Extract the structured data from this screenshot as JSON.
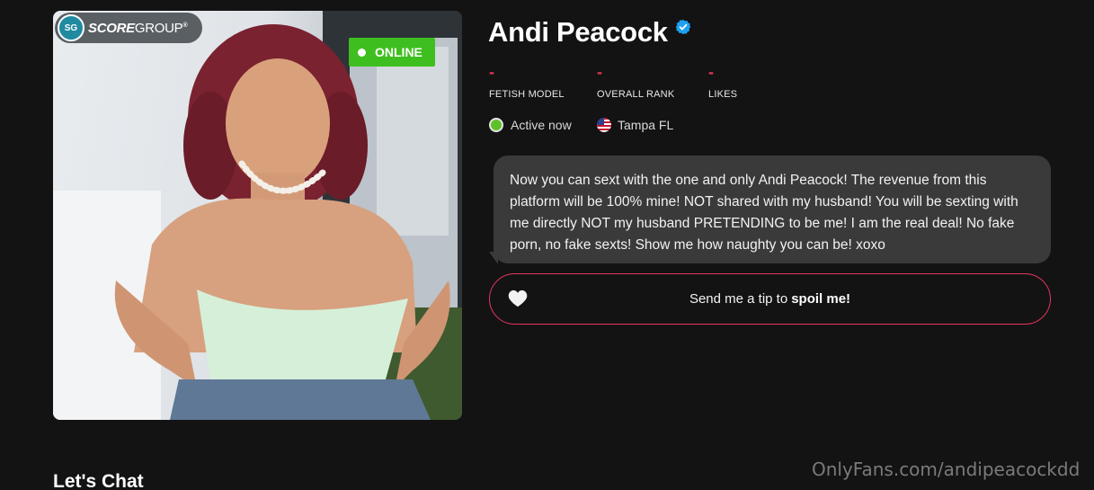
{
  "profile": {
    "name": "Andi Peacock",
    "verified_icon": "verified-check-icon",
    "photo_badge": "ONLINE",
    "logo": {
      "mark": "SG",
      "text_bold": "SCORE",
      "text_thin": "GROUP",
      "registered": "®"
    }
  },
  "stats": [
    {
      "value": "-",
      "label": "FETISH MODEL"
    },
    {
      "value": "-",
      "label": "OVERALL RANK"
    },
    {
      "value": "-",
      "label": "LIKES"
    }
  ],
  "status": {
    "active": "Active now",
    "location": "Tampa FL"
  },
  "bio": "Now you can sext with the one and only Andi Peacock! The revenue from this platform will be 100% mine! NOT shared with my husband! You will be sexting with me directly NOT my husband PRETENDING to be me! I am the real deal! No fake porn, no fake sexts! Show me how naughty you can be! xoxo",
  "tip": {
    "prefix": "Send me a tip to",
    "bold": "spoil me!"
  },
  "section": {
    "chat_title": "Let's Chat"
  },
  "watermark": "OnlyFans.com/andipeacockdd",
  "colors": {
    "accent": "#e8355f",
    "online": "#3fbf1f",
    "background": "#131313",
    "bubble": "#3a3a3a"
  }
}
